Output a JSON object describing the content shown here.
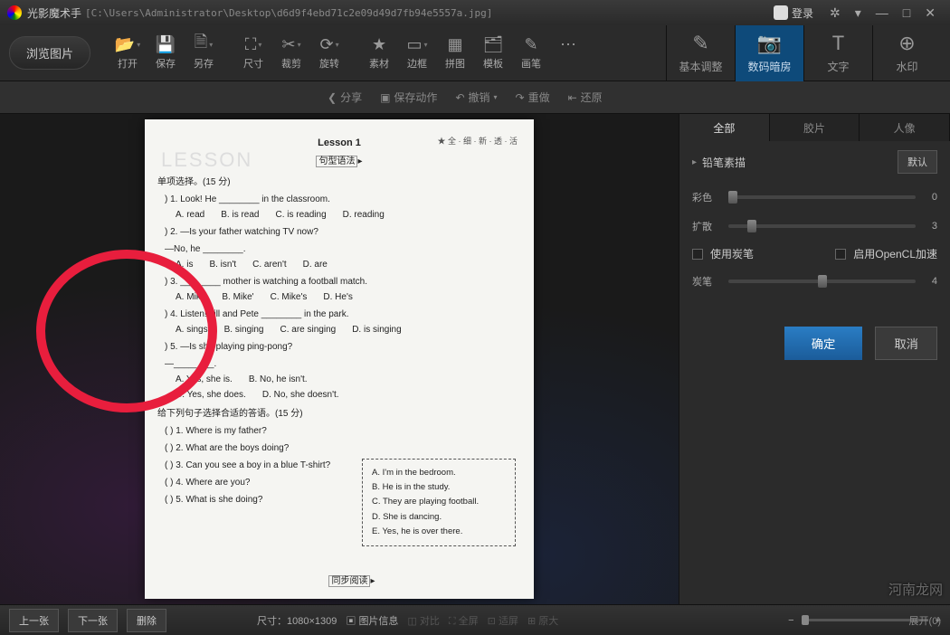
{
  "title": {
    "app": "光影魔术手",
    "path": "[C:\\Users\\Administrator\\Desktop\\d6d9f4ebd71c2e09d49d7fb94e5557a.jpg]"
  },
  "win": {
    "login": "登录",
    "gear": "✲",
    "down": "▾",
    "min": "—",
    "max": "□",
    "close": "✕"
  },
  "browse": "浏览图片",
  "tb": [
    {
      "l": "打开",
      "i": "📂"
    },
    {
      "l": "保存",
      "i": "💾"
    },
    {
      "l": "另存",
      "i": "🗎"
    },
    {
      "l": "尺寸",
      "i": "⛶"
    },
    {
      "l": "裁剪",
      "i": "✂"
    },
    {
      "l": "旋转",
      "i": "⟳"
    },
    {
      "l": "素材",
      "i": "★"
    },
    {
      "l": "边框",
      "i": "▭"
    },
    {
      "l": "拼图",
      "i": "▦"
    },
    {
      "l": "模板",
      "i": "🗂"
    },
    {
      "l": "画笔",
      "i": "✎"
    },
    {
      "l": "",
      "i": "⋯"
    }
  ],
  "rtabs": [
    {
      "l": "基本调整",
      "i": "✎"
    },
    {
      "l": "数码暗房",
      "i": "📷"
    },
    {
      "l": "文字",
      "i": "T"
    },
    {
      "l": "水印",
      "i": "⊕"
    }
  ],
  "actions": {
    "share": "分享",
    "saveact": "保存动作",
    "undo": "撤销",
    "redo": "重做",
    "restore": "还原"
  },
  "side": {
    "tabs": [
      "全部",
      "胶片",
      "人像"
    ],
    "section": "铅笔素描",
    "default": "默认",
    "s1": {
      "l": "彩色",
      "v": "0"
    },
    "s2": {
      "l": "扩散",
      "v": "3"
    },
    "s3": {
      "l": "炭笔",
      "v": "4"
    },
    "c1": "使用炭笔",
    "c2": "启用OpenCL加速",
    "ok": "确定",
    "cancel": "取消"
  },
  "bottom": {
    "prev": "上一张",
    "next": "下一张",
    "del": "删除",
    "size": "尺寸：1080×1309",
    "info": "图片信息",
    "compare": "对比",
    "full": "全屏",
    "fit": "适屏",
    "orig": "原大",
    "expand": "展开(0)"
  },
  "doc": {
    "lesson": "Lesson 1",
    "topr": "★ 全 · 细 · 新 · 透 · 活",
    "sec1": "句型语法",
    "h1": "单项选择。(15 分)",
    "q1": ") 1. Look! He ________ in the classroom.",
    "a1": [
      "A. read",
      "B. is read",
      "C. is reading",
      "D. reading"
    ],
    "q2": ") 2. —Is your father watching TV now?",
    "q2b": "—No, he ________.",
    "a2": [
      "A. is",
      "B. isn't",
      "C. aren't",
      "D. are"
    ],
    "q3": ") 3. ________ mother is watching a football match.",
    "a3": [
      "A. Mike",
      "B. Mike'",
      "C. Mike's",
      "D. He's"
    ],
    "q4": ") 4. Listen! Jill and Pete ________ in the park.",
    "a4": [
      "A. sings",
      "B. singing",
      "C. are singing",
      "D. is singing"
    ],
    "q5": ") 5. —Is she playing ping-pong?",
    "q5b": "—________.",
    "a5": [
      "A. Yes, she is.",
      "B. No, he isn't.",
      "C. Yes, she does.",
      "D. No, she doesn't."
    ],
    "h2": "给下列句子选择合适的答语。(15 分)",
    "m": [
      ") 1. Where is my father?",
      ") 2. What are the boys doing?",
      ") 3. Can you see a boy in a blue T-shirt?",
      ") 4. Where are you?",
      ") 5. What is she doing?"
    ],
    "box": [
      "A. I'm in the bedroom.",
      "B. He is in the study.",
      "C. They are playing football.",
      "D. She is dancing.",
      "E. Yes, he is over there."
    ],
    "foot": "同步阅读",
    "faint": "LESSON"
  },
  "wm": "河南龙网"
}
